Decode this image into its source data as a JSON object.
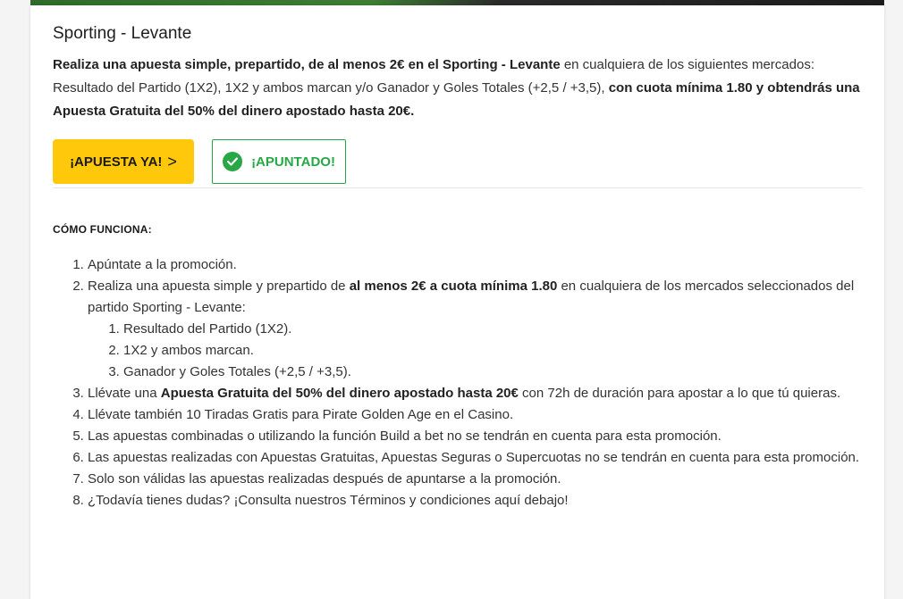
{
  "promo": {
    "title": "Sporting - Levante",
    "intro": {
      "p1_bold": "Realiza una apuesta simple, prepartido, de al menos 2€ en el Sporting - Levante",
      "p2": " en cualquiera de los siguientes mercados: Resultado del Partido (1X2), 1X2 y ambos marcan y/o Ganador y Goles Totales (+2,5 / +3,5), ",
      "p3_bold": "con cuota mínima 1.80 y obtendrás una Apuesta Gratuita del 50% del dinero apostado hasta 20€."
    },
    "bet_button": "¡APUESTA YA!",
    "bet_chevron": ">",
    "joined_button": "¡APUNTADO!",
    "colors": {
      "accent_yellow": "#ffc80a",
      "success_green": "#27a844"
    }
  },
  "how": {
    "title": "CÓMO FUNCIONA:",
    "step1": "Apúntate a la promoción.",
    "step2": {
      "a": "Realiza una apuesta simple y prepartido de ",
      "b_bold": "al menos 2€ a cuota mínima 1.80",
      "c": " en cualquiera de los mercados seleccionados del partido Sporting - Levante:",
      "sub": [
        "Resultado del Partido (1X2).",
        "1X2 y ambos marcan.",
        "Ganador y Goles Totales (+2,5 / +3,5)."
      ]
    },
    "step3": {
      "a": "Llévate una ",
      "b_bold": "Apuesta Gratuita del 50% del dinero apostado hasta 20€",
      "c": " con 72h de duración para apostar a lo que tú quieras."
    },
    "step4": "Llévate también 10 Tiradas Gratis para Pirate Golden Age en el Casino.",
    "step5": "Las apuestas combinadas o utilizando la función Build a bet no se tendrán en cuenta para esta promoción.",
    "step6": "Las apuestas realizadas con Apuestas Gratuitas, Apuestas Seguras o Supercuotas no se tendrán en cuenta para esta promoción.",
    "step7": "Solo son válidas las apuestas realizadas después de apuntarse a la promoción.",
    "step8": "¿Todavía tienes dudas? ¡Consulta nuestros Términos y condiciones aquí debajo!"
  }
}
